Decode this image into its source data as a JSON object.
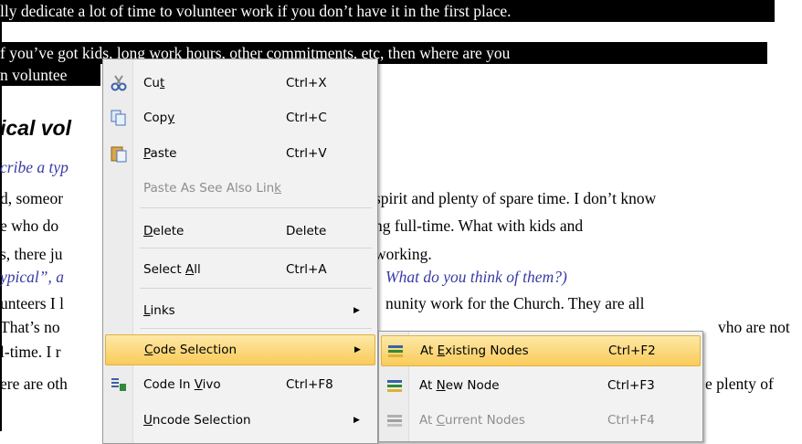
{
  "document": {
    "lines": [
      "lly dedicate a lot of time to volunteer work if you don’t have it in the first place.",
      "f you’ve got kids, long work hours, other commitments, etc, then where are you",
      "n voluntee",
      "ical vol",
      "cribe a typ",
      "d, someor",
      "spirit and plenty of spare time.  I don’t know",
      "e who do",
      "ng full-time.  What with kids and",
      "s, there ju",
      "working.",
      "ypical”, a",
      "What do you think of them?)",
      "unteers I l",
      "nunity work for the Church.  They are all",
      " That’s no",
      "vho are not",
      "l-time. I r",
      "ere are oth",
      "e plenty of"
    ]
  },
  "context_menu": {
    "items": [
      {
        "label_pre": "Cu",
        "label_ul": "t",
        "label_post": "",
        "shortcut": "Ctrl+X",
        "icon": "scissors-icon"
      },
      {
        "label_pre": "Cop",
        "label_ul": "y",
        "label_post": "",
        "shortcut": "Ctrl+C",
        "icon": "copy-icon"
      },
      {
        "label_pre": "",
        "label_ul": "P",
        "label_post": "aste",
        "shortcut": "Ctrl+V",
        "icon": "paste-icon"
      },
      {
        "label_pre": "Paste As See Also Lin",
        "label_ul": "k",
        "label_post": "",
        "shortcut": "",
        "icon": ""
      },
      {
        "label_pre": "",
        "label_ul": "D",
        "label_post": "elete",
        "shortcut": "Delete",
        "icon": ""
      },
      {
        "label_pre": "Select ",
        "label_ul": "A",
        "label_post": "ll",
        "shortcut": "Ctrl+A",
        "icon": ""
      },
      {
        "label_pre": "",
        "label_ul": "L",
        "label_post": "inks",
        "shortcut": "",
        "icon": ""
      },
      {
        "label_pre": "",
        "label_ul": "C",
        "label_post": "ode Selection",
        "shortcut": "",
        "icon": ""
      },
      {
        "label_pre": "Code In ",
        "label_ul": "V",
        "label_post": "ivo",
        "shortcut": "Ctrl+F8",
        "icon": "code-in-vivo-icon"
      },
      {
        "label_pre": "",
        "label_ul": "U",
        "label_post": "ncode Selection",
        "shortcut": "",
        "icon": ""
      }
    ]
  },
  "submenu": {
    "items": [
      {
        "label_pre": "At ",
        "label_ul": "E",
        "label_post": "xisting Nodes",
        "shortcut": "Ctrl+F2",
        "icon": "code-existing-icon"
      },
      {
        "label_pre": "At ",
        "label_ul": "N",
        "label_post": "ew Node",
        "shortcut": "Ctrl+F3",
        "icon": "code-new-icon"
      },
      {
        "label_pre": "At ",
        "label_ul": "C",
        "label_post": "urrent Nodes",
        "shortcut": "Ctrl+F4",
        "icon": "code-current-icon"
      }
    ]
  },
  "colors": {
    "highlight_top": "#fde8a6",
    "highlight_bottom": "#f9cb5a",
    "menu_bg": "#f2f2f2",
    "doc_blue": "#3a3aa6"
  }
}
